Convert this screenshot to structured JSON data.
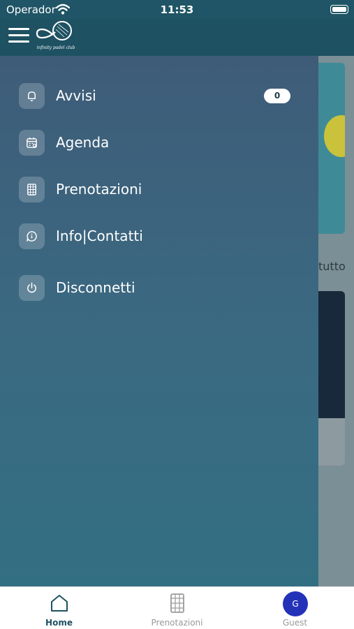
{
  "status_bar": {
    "carrier": "Operador",
    "time": "11:53"
  },
  "header": {
    "logo_text": "infinity padel club"
  },
  "background_page": {
    "partial_text": "tutto"
  },
  "drawer": {
    "items": [
      {
        "label": "Avvisi",
        "icon": "bell-icon",
        "badge": "0"
      },
      {
        "label": "Agenda",
        "icon": "calendar-icon"
      },
      {
        "label": "Prenotazioni",
        "icon": "court-icon"
      },
      {
        "label": "Info|Contatti",
        "icon": "info-bubble-icon"
      },
      {
        "label": "Disconnetti",
        "icon": "power-icon"
      }
    ]
  },
  "tab_bar": {
    "tabs": [
      {
        "label": "Home",
        "icon": "home-icon",
        "active": true
      },
      {
        "label": "Prenotazioni",
        "icon": "court-icon",
        "active": false
      },
      {
        "label": "Guest",
        "icon": "avatar",
        "avatar_initial": "G",
        "active": false
      }
    ]
  },
  "colors": {
    "header": "#1e5162",
    "drawer_top": "#3e5c78",
    "drawer_bottom": "#336f82",
    "avatar": "#2432b8",
    "active_tab": "#1e5162"
  }
}
